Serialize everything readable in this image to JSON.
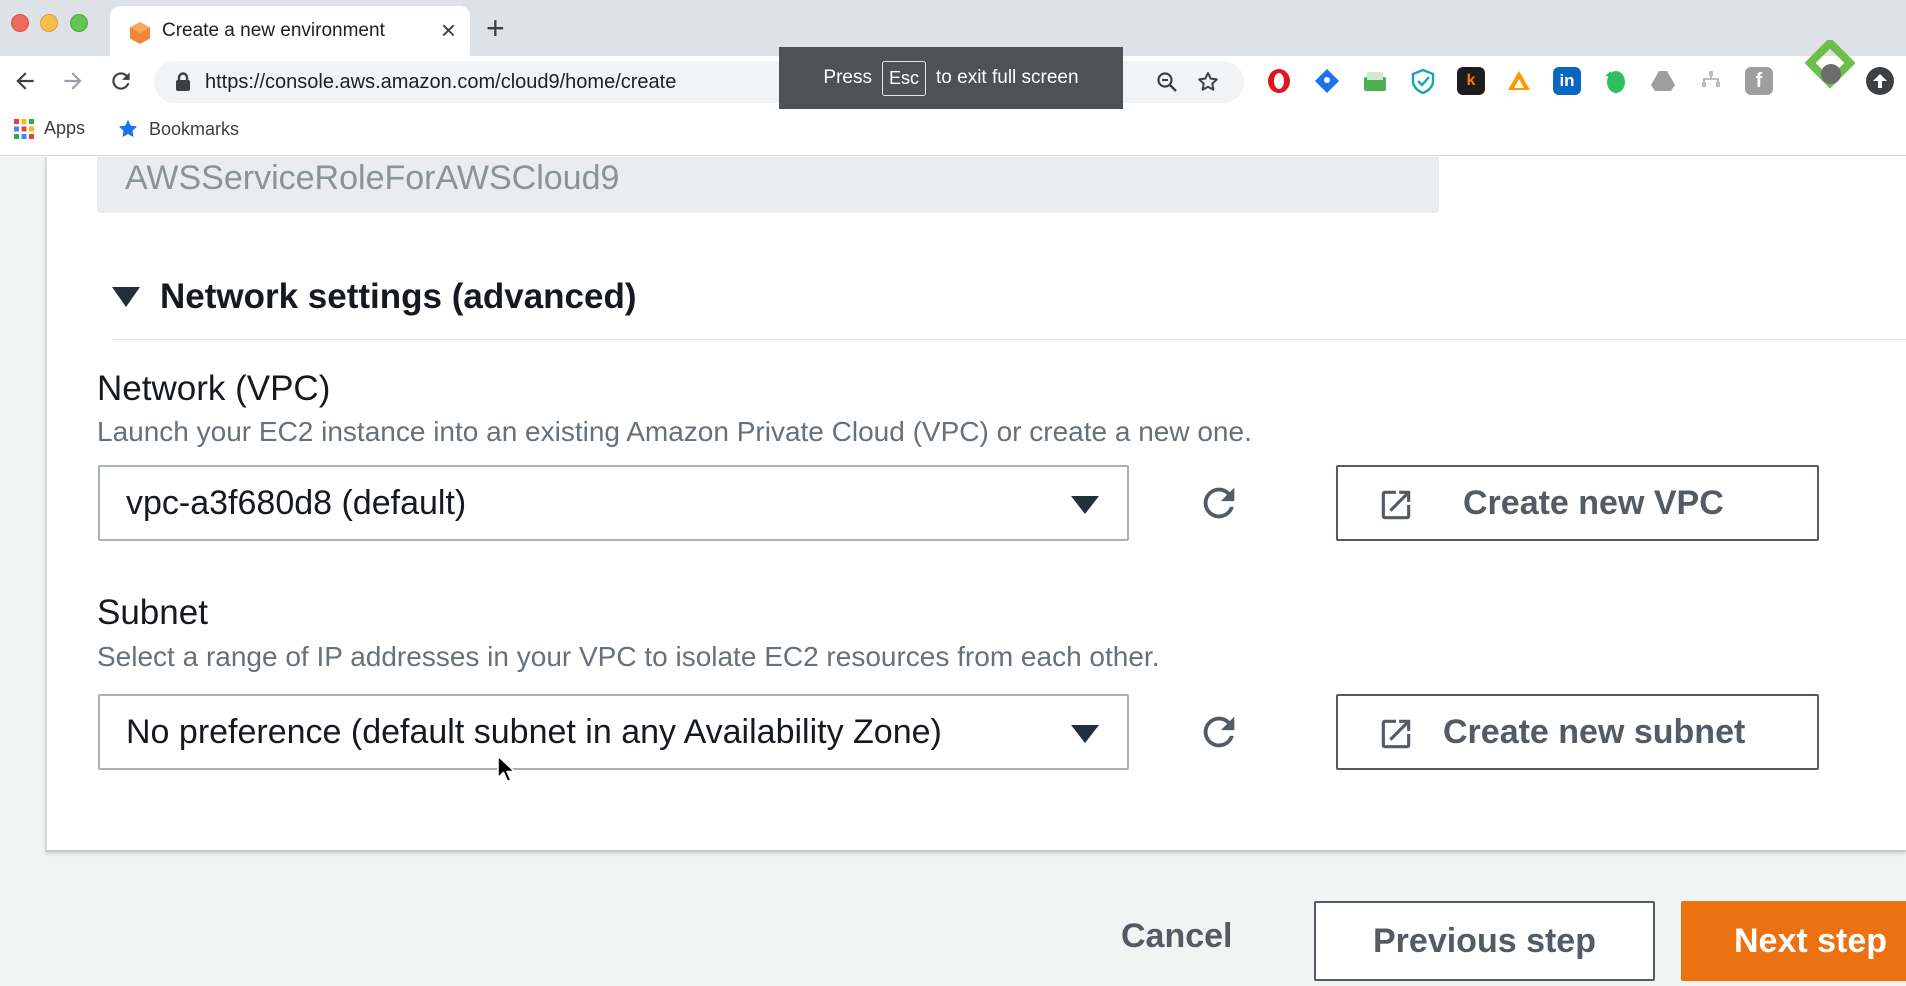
{
  "browser": {
    "tab_title": "Create a new environment",
    "url": "https://console.aws.amazon.com/cloud9/home/create",
    "bookmarks": [
      {
        "label": "Apps",
        "icon": "apps-grid-icon"
      },
      {
        "label": "Bookmarks",
        "icon": "star-icon"
      }
    ],
    "fullscreen_notice": {
      "before": "Press",
      "key": "Esc",
      "after": "to exit full screen"
    },
    "extensions": [
      "opera-icon",
      "bitwarden-icon",
      "inbox-icon",
      "shield-icon",
      "k-icon",
      "triangle-icon",
      "linkedin-icon",
      "evernote-icon",
      "drive-icon",
      "tree-icon",
      "facebook-icon",
      "feedly-icon",
      "profile-icon",
      "update-icon"
    ]
  },
  "form": {
    "service_role": "AWSServiceRoleForAWSCloud9",
    "network_section_title": "Network settings (advanced)",
    "vpc": {
      "label": "Network (VPC)",
      "description": "Launch your EC2 instance into an existing Amazon Private Cloud (VPC) or create a new one.",
      "value": "vpc-a3f680d8 (default)",
      "create_label": "Create new VPC"
    },
    "subnet": {
      "label": "Subnet",
      "description": "Select a range of IP addresses in your VPC to isolate EC2 resources from each other.",
      "value": "No preference (default subnet in any Availability Zone)",
      "create_label": "Create new subnet"
    }
  },
  "footer": {
    "cancel_label": "Cancel",
    "previous_label": "Previous step",
    "next_label": "Next step"
  },
  "colors": {
    "primary_button": "#ec7211",
    "aws_orange": "#ff9900"
  }
}
